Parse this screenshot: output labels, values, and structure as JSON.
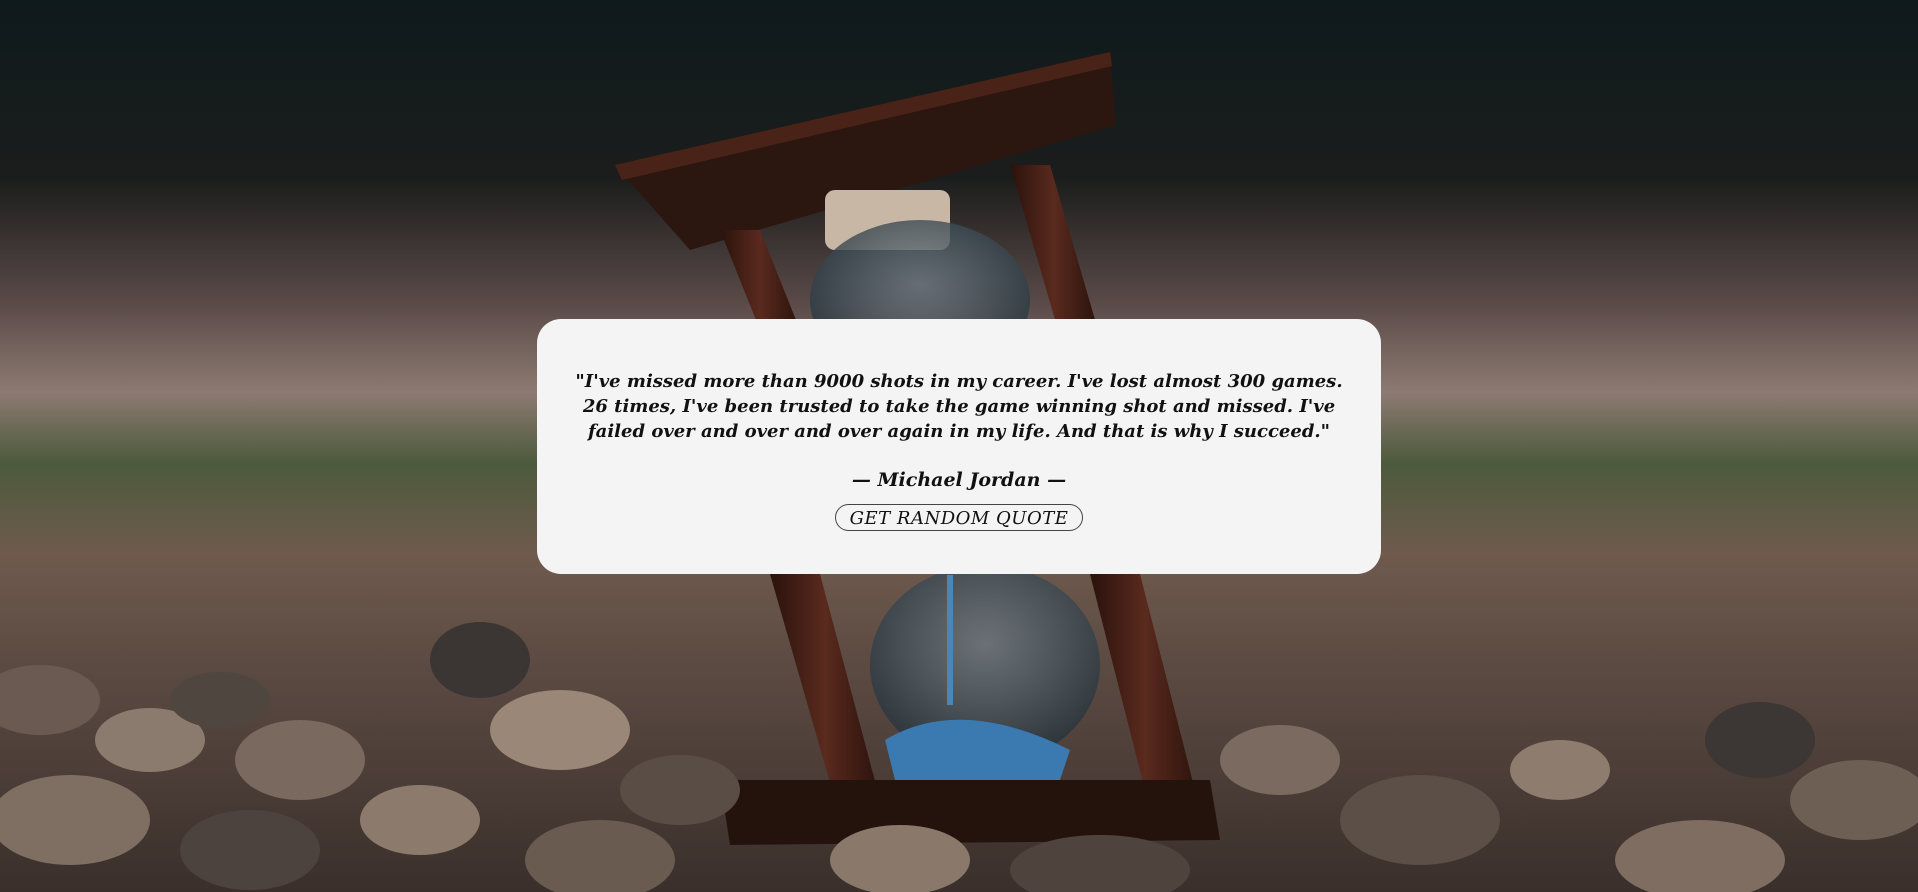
{
  "quote": {
    "text": "\"I've missed more than 9000 shots in my career. I've lost almost 300 games. 26 times, I've been trusted to take the game winning shot and missed. I've failed over and over and over again in my life. And that is why I succeed.\"",
    "author": "— Michael Jordan —"
  },
  "actions": {
    "random_quote_label": "GET RANDOM QUOTE"
  },
  "background": {
    "subject": "hourglass-on-pebbles-photo",
    "sand_color": "#3a7ab0"
  }
}
